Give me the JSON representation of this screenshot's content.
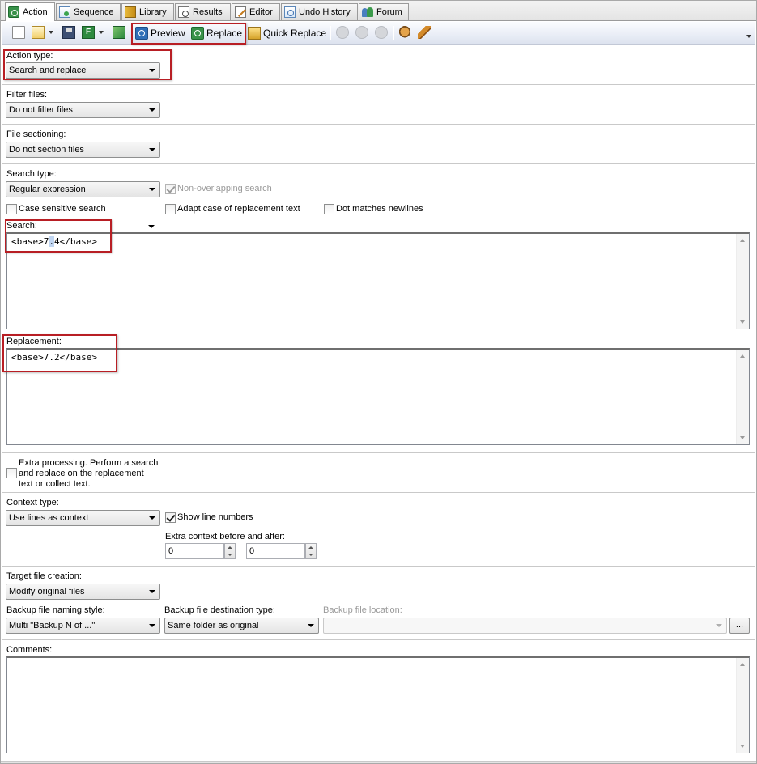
{
  "tabs": [
    {
      "label": "Action",
      "icon": "action-icon",
      "active": true
    },
    {
      "label": "Sequence",
      "icon": "sequence-icon"
    },
    {
      "label": "Library",
      "icon": "library-icon"
    },
    {
      "label": "Results",
      "icon": "results-icon"
    },
    {
      "label": "Editor",
      "icon": "editor-icon"
    },
    {
      "label": "Undo History",
      "icon": "undo-history-icon"
    },
    {
      "label": "Forum",
      "icon": "forum-icon"
    }
  ],
  "toolbar": {
    "preview_label": "Preview",
    "replace_label": "Replace",
    "quick_replace_label": "Quick Replace"
  },
  "action_type": {
    "label": "Action type:",
    "value": "Search and replace"
  },
  "filter_files": {
    "label": "Filter files:",
    "value": "Do not filter files"
  },
  "file_sectioning": {
    "label": "File sectioning:",
    "value": "Do not section files"
  },
  "search_type": {
    "label": "Search type:",
    "value": "Regular expression",
    "non_overlapping": "Non-overlapping search",
    "case_sensitive": "Case sensitive search",
    "adapt_case": "Adapt case of replacement text",
    "dot_matches": "Dot matches newlines"
  },
  "search": {
    "label": "Search:",
    "text_before": "<base>7",
    "text_selected": ".",
    "text_after": "4</base>"
  },
  "replacement": {
    "label": "Replacement:",
    "text": "<base>7.2</base>"
  },
  "extra_processing": {
    "line1": "Extra processing. Perform a search",
    "line2": "and replace on the replacement",
    "line3": "text or collect text."
  },
  "context": {
    "label": "Context type:",
    "value": "Use lines as context",
    "show_line_numbers": "Show line numbers",
    "extra_label": "Extra context before and after:",
    "before": "0",
    "after": "0"
  },
  "target": {
    "label": "Target file creation:",
    "value": "Modify original files"
  },
  "backup": {
    "naming_label": "Backup file naming style:",
    "naming_value": "Multi \"Backup N of ...\"",
    "dest_label": "Backup file destination type:",
    "dest_value": "Same folder as original",
    "location_label": "Backup file location:",
    "location_value": "",
    "browse_label": "..."
  },
  "comments": {
    "label": "Comments:",
    "text": ""
  },
  "colors": {
    "highlight": "#b81e24",
    "selection": "#c1d6f2",
    "accent": "#2f6fb7"
  }
}
